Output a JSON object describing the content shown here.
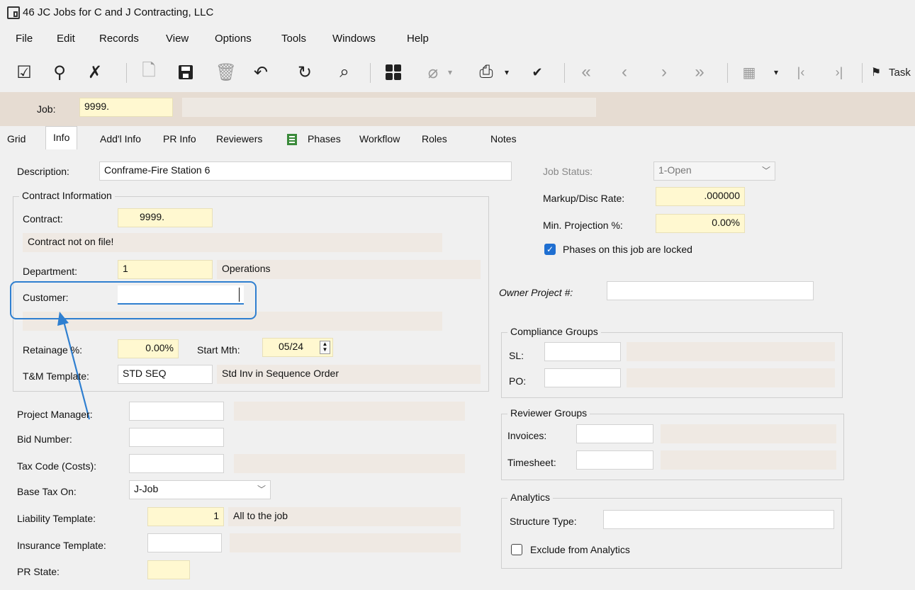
{
  "window": {
    "title": "46 JC Jobs for C and J Contracting, LLC"
  },
  "menu": [
    "File",
    "Edit",
    "Records",
    "View",
    "Options",
    "Tools",
    "Windows",
    "Help"
  ],
  "toolbar": {
    "tasks_label": "Task"
  },
  "key": {
    "job_label": "Job:",
    "job_value": "9999."
  },
  "tabs": [
    "Grid",
    "Info",
    "Add'l Info",
    "PR Info",
    "Reviewers",
    "Phases",
    "Workflow",
    "Roles",
    "Notes"
  ],
  "form": {
    "description_label": "Description:",
    "description_value": "Conframe-Fire Station 6",
    "contract_group_title": "Contract Information",
    "contract_label": "Contract:",
    "contract_value": "9999.",
    "contract_desc": "Contract not on file!",
    "department_label": "Department:",
    "department_value": "1",
    "department_desc": "Operations",
    "customer_label": "Customer:",
    "customer_value": "",
    "retainage_label": "Retainage %:",
    "retainage_value": "0.00%",
    "start_mth_label": "Start Mth:",
    "start_mth_value": "05/24",
    "tm_template_label": "T&M Template:",
    "tm_template_value": "STD SEQ",
    "tm_template_desc": "Std Inv in Sequence Order",
    "project_manager_label": "Project Manager:",
    "bid_number_label": "Bid Number:",
    "tax_code_label": "Tax Code (Costs):",
    "base_tax_on_label": "Base Tax On:",
    "base_tax_on_value": "J-Job",
    "liability_template_label": "Liability Template:",
    "liability_template_value": "1",
    "liability_template_desc": "All to the job",
    "insurance_template_label": "Insurance Template:",
    "pr_state_label": "PR State:",
    "job_status_label": "Job Status:",
    "job_status_value": "1-Open",
    "markup_label": "Markup/Disc Rate:",
    "markup_value": ".000000",
    "min_projection_label": "Min. Projection %:",
    "min_projection_value": "0.00%",
    "phases_locked_label": "Phases on this job are locked",
    "owner_project_label": "Owner Project #:",
    "compliance_title": "Compliance Groups",
    "sl_label": "SL:",
    "po_label": "PO:",
    "reviewer_title": "Reviewer Groups",
    "invoices_label": "Invoices:",
    "timesheet_label": "Timesheet:",
    "analytics_title": "Analytics",
    "structure_type_label": "Structure Type:",
    "exclude_analytics_label": "Exclude from Analytics"
  },
  "colors": {
    "accent": "#2f7fd0",
    "yellow_field": "#fff8d0",
    "readonly_field": "#efe9e3",
    "key_bar": "#e6dcd2"
  }
}
